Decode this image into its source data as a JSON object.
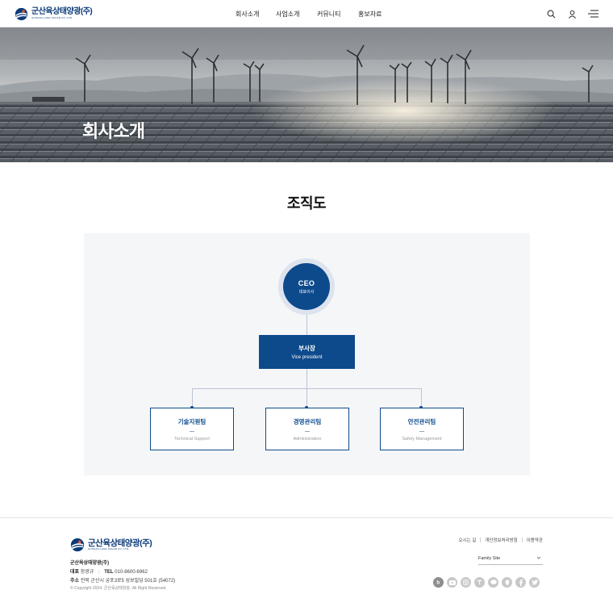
{
  "header": {
    "logo_text": "군산육상태양광(주)",
    "logo_sub": "GUNSAN LAND SOLAR CO.,LTD.",
    "nav": [
      {
        "label": "회사소개"
      },
      {
        "label": "사업소개"
      },
      {
        "label": "커뮤니티"
      },
      {
        "label": "홍보자료"
      }
    ],
    "icons": [
      "search-icon",
      "user-icon",
      "menu-icon"
    ]
  },
  "hero": {
    "title": "회사소개"
  },
  "section": {
    "title": "조직도"
  },
  "org": {
    "ceo": {
      "title": "CEO",
      "sub": "대표이사"
    },
    "vp": {
      "title": "부사장",
      "sub": "Vice president"
    },
    "teams": [
      {
        "title": "기술지원팀",
        "dash": "—",
        "sub": "Technical Support"
      },
      {
        "title": "경영관리팀",
        "dash": "—",
        "sub": "Administration"
      },
      {
        "title": "안전관리팀",
        "dash": "—",
        "sub": "Safety Management"
      }
    ]
  },
  "footer": {
    "logo_text": "군산육상태양광(주)",
    "logo_sub": "GUNSAN LAND SOLAR CO.,LTD.",
    "company": "군산육상태양광(주)",
    "rep_label": "대표",
    "rep_name": "장광규",
    "tel_label": "TEL",
    "tel": "010-8600-6962",
    "addr_label": "주소",
    "addr": "전북 군산시 궁포3로5 성보빌딩 501호 (54072)",
    "copyright": "© Copyright 2024. 군산육상태양광. All Right Reserved.",
    "links": [
      {
        "label": "오시는 길"
      },
      {
        "label": "개인정보처리방침"
      },
      {
        "label": "이용약관"
      }
    ],
    "family_site": "Family Site",
    "sns": [
      "blog-icon",
      "youtube-icon",
      "instagram-icon",
      "t-icon",
      "talk-icon",
      "pin-icon",
      "facebook-icon",
      "twitter-icon"
    ]
  },
  "colors": {
    "brand": "#0d4a8c",
    "panel": "#f5f6f8"
  }
}
